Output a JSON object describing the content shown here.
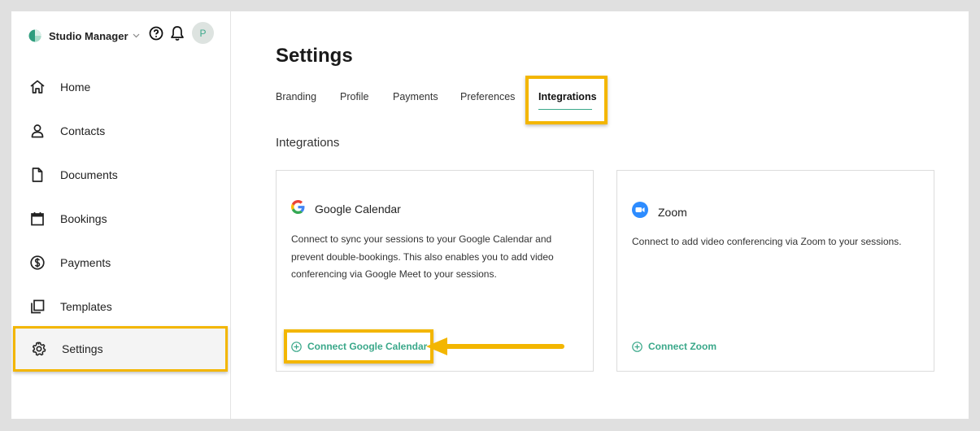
{
  "brand": {
    "name": "Studio Manager",
    "avatar_initial": "P"
  },
  "sidebar": {
    "items": [
      {
        "label": "Home",
        "icon": "home-icon"
      },
      {
        "label": "Contacts",
        "icon": "person-icon"
      },
      {
        "label": "Documents",
        "icon": "document-icon"
      },
      {
        "label": "Bookings",
        "icon": "calendar-icon"
      },
      {
        "label": "Payments",
        "icon": "dollar-icon"
      },
      {
        "label": "Templates",
        "icon": "templates-icon"
      },
      {
        "label": "Settings",
        "icon": "gear-icon",
        "active": true
      }
    ]
  },
  "main": {
    "title": "Settings",
    "tabs": [
      {
        "label": "Branding"
      },
      {
        "label": "Profile"
      },
      {
        "label": "Payments"
      },
      {
        "label": "Preferences"
      },
      {
        "label": "Integrations",
        "active": true
      }
    ],
    "section_title": "Integrations",
    "integrations": [
      {
        "name": "Google Calendar",
        "icon": "google-icon",
        "description": "Connect to sync your sessions to your Google Calendar and prevent double-bookings. This also enables you to add video conferencing via Google Meet to your sessions.",
        "action": "Connect Google Calendar"
      },
      {
        "name": "Zoom",
        "icon": "zoom-icon",
        "description": "Connect to add video conferencing via Zoom to your sessions.",
        "action": "Connect Zoom"
      }
    ]
  },
  "colors": {
    "accent": "#3aa88a",
    "highlight": "#f3b600"
  }
}
